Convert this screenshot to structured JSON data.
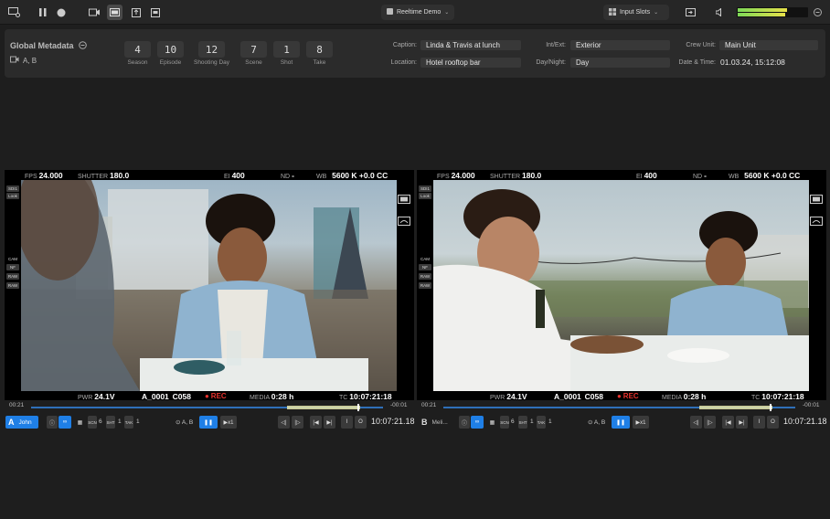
{
  "toolbar": {
    "project": "Reeltime Demo",
    "input_slots": "Input Slots"
  },
  "metadata": {
    "title": "Global Metadata",
    "cameras": "A, B",
    "counters": [
      {
        "value": "4",
        "label": "Season"
      },
      {
        "value": "10",
        "label": "Episode"
      },
      {
        "value": "12",
        "label": "Shooting Day"
      },
      {
        "value": "7",
        "label": "Scene"
      },
      {
        "value": "1",
        "label": "Shot"
      },
      {
        "value": "8",
        "label": "Take"
      }
    ],
    "caption_label": "Caption:",
    "caption": "Linda & Travis at lunch",
    "location_label": "Location:",
    "location": "Hotel rooftop bar",
    "intext_label": "Int/Ext:",
    "intext": "Exterior",
    "daynight_label": "Day/Night:",
    "daynight": "Day",
    "crew_label": "Crew Unit:",
    "crew": "Main Unit",
    "datetime_label": "Date & Time:",
    "datetime": "01.03.24, 15:12:08"
  },
  "viewers": [
    {
      "fps_label": "FPS",
      "fps": "24.000",
      "shutter_label": "SHUTTER",
      "shutter": "180.0",
      "ei_label": "EI",
      "ei": "400",
      "nd_label": "ND",
      "nd": "-",
      "wb_label": "WB",
      "wb": "5600 K +0.0 CC",
      "side_top": [
        "SDI1",
        "Look"
      ],
      "side_mid": [
        "CAM",
        "NF",
        "RAW",
        "RAW"
      ],
      "pwr_label": "PWR",
      "pwr": "24.1V",
      "clip": "A_0001",
      "clip2": "C058",
      "rec": "REC",
      "media_label": "MEDIA",
      "media": "0:28 h",
      "tc_label": "TC",
      "tc": "10:07:21:18",
      "time_start": "00:21",
      "time_end": "-00:01",
      "cam_letter": "A",
      "cam_name": "John",
      "stat1_label": "6",
      "stat2_label": "1",
      "stat3_label": "1",
      "channels": "A, B",
      "timecode": "10:07:21.18"
    },
    {
      "fps_label": "FPS",
      "fps": "24.000",
      "shutter_label": "SHUTTER",
      "shutter": "180.0",
      "ei_label": "EI",
      "ei": "400",
      "nd_label": "ND",
      "nd": "-",
      "wb_label": "WB",
      "wb": "5600 K +0.0 CC",
      "side_top": [
        "SDI1",
        "Look"
      ],
      "side_mid": [
        "CAM",
        "NF",
        "RAW",
        "RAW"
      ],
      "pwr_label": "PWR",
      "pwr": "24.1V",
      "clip": "A_0001",
      "clip2": "C058",
      "rec": "REC",
      "media_label": "MEDIA",
      "media": "0:28 h",
      "tc_label": "TC",
      "tc": "10:07:21:18",
      "time_start": "00:21",
      "time_end": "-00:01",
      "cam_letter": "B",
      "cam_name": "Meli...",
      "stat1_label": "6",
      "stat2_label": "1",
      "stat3_label": "1",
      "channels": "A, B",
      "timecode": "10:07:21.18"
    }
  ],
  "colors": {
    "accent": "#1f7fe6",
    "rec": "#e8322d",
    "meter_green": "#7ed957",
    "meter_yellow": "#e6e04a"
  }
}
